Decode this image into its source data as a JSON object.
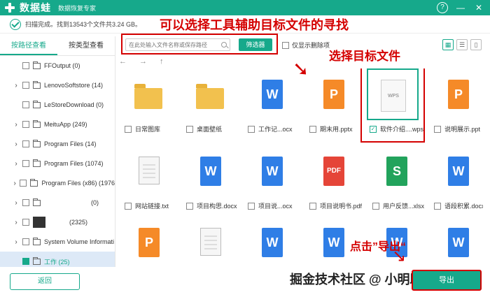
{
  "app": {
    "title": "数据蛙",
    "subtitle": "数据恢复专家",
    "help_label": "?",
    "min_label": "—",
    "close_label": "✕"
  },
  "scan": {
    "status": "扫描完成。找到13543个文件共3.24 GB。"
  },
  "annotations": {
    "tool_hint": "可以选择工具辅助目标文件的寻找",
    "select_hint": "选择目标文件",
    "export_hint": "点击”导出“"
  },
  "sidebar": {
    "tabs": [
      "按路径查看",
      "按类型查看"
    ],
    "items": [
      {
        "label": "FFOutput (0)",
        "chevron": false
      },
      {
        "label": "LenovoSoftstore (14)",
        "chevron": true
      },
      {
        "label": "LeStoreDownload (0)",
        "chevron": false
      },
      {
        "label": "MeituApp (249)",
        "chevron": true
      },
      {
        "label": "Program Files (14)",
        "chevron": true
      },
      {
        "label": "Program Files (1074)",
        "chevron": true
      },
      {
        "label": "Program Files (x86) (1976",
        "chevron": true
      },
      {
        "label": "(0)",
        "chevron": true
      },
      {
        "label": "(2325)",
        "chevron": true
      },
      {
        "label": "System Volume Informati",
        "chevron": true
      },
      {
        "label": "工作 (25)",
        "chevron": false
      }
    ],
    "back_label": "返回"
  },
  "toolbar": {
    "search_placeholder": "在此处输入文件名称或保存路径",
    "filter_label": "筛选器",
    "show_deleted_label": "仅显示删除项"
  },
  "nav": {
    "back": "←",
    "forward": "→",
    "up": "↑"
  },
  "files": [
    {
      "name": "日常图库",
      "icon": "folder-icon"
    },
    {
      "name": "桌面壁纸",
      "icon": "folder-icon"
    },
    {
      "name": "工作记...ocx",
      "icon": "word-icon"
    },
    {
      "name": "期末用.pptx",
      "icon": "ppt-icon"
    },
    {
      "name": "软件介绍....wps",
      "icon": "wps-icon",
      "selected": true
    },
    {
      "name": "说明展示.ppt",
      "icon": "ppt-icon"
    },
    {
      "name": "网站链接.txt",
      "icon": "text-icon"
    },
    {
      "name": "项目构思.docx",
      "icon": "word-icon"
    },
    {
      "name": "项目说...ocx",
      "icon": "word-icon"
    },
    {
      "name": "项目说明书.pdf",
      "icon": "pdf-icon"
    },
    {
      "name": "用户反馈...xlsx",
      "icon": "excel-icon"
    },
    {
      "name": "语段积累.docx",
      "icon": "word-icon"
    },
    {
      "name": "",
      "icon": "ppt-icon"
    },
    {
      "name": "",
      "icon": "text-icon"
    },
    {
      "name": "",
      "icon": "word-icon"
    },
    {
      "name": "",
      "icon": "word-icon"
    },
    {
      "name": "",
      "icon": "word-icon"
    },
    {
      "name": "",
      "icon": "word-icon"
    }
  ],
  "footer": {
    "export_label": "导出",
    "watermark": "掘金技术社区 @ 小明助手"
  },
  "colors": {
    "accent": "#16a98b",
    "annotation": "#d40000"
  }
}
